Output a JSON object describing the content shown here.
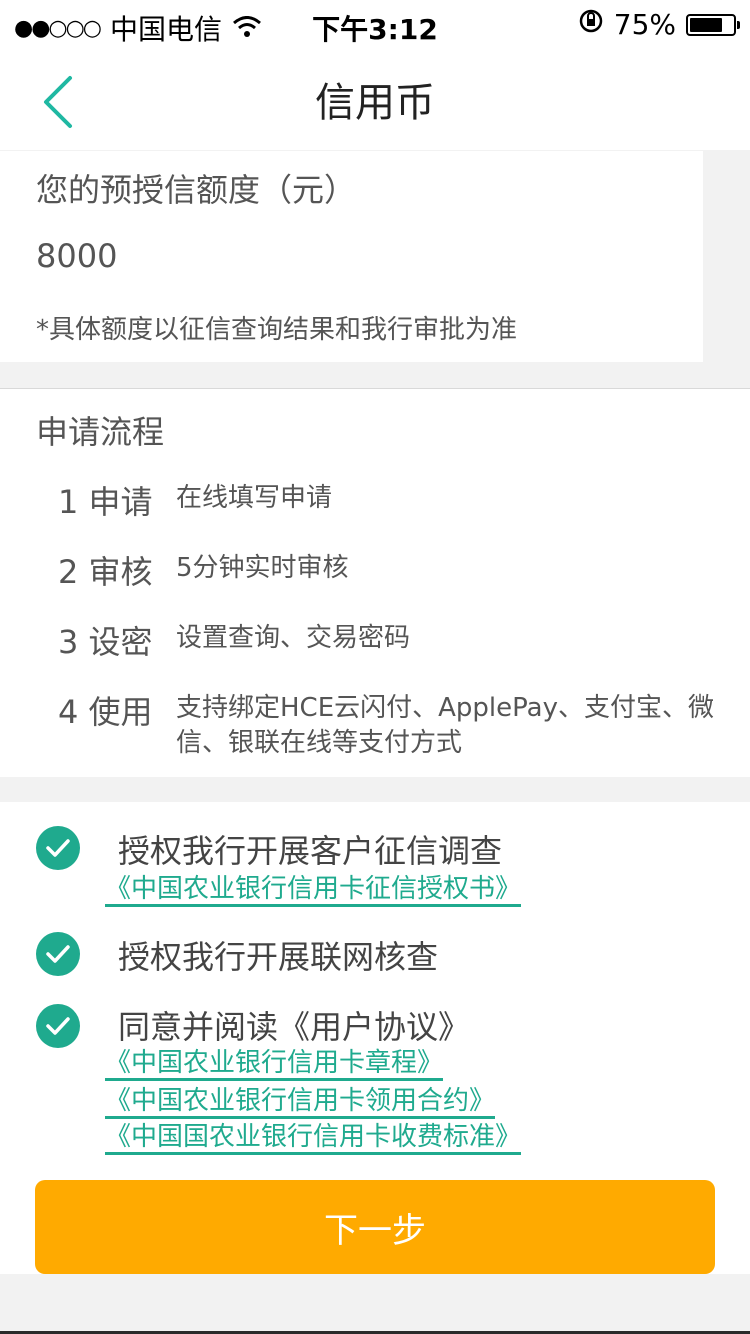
{
  "status_bar": {
    "signal": "●●○○○",
    "carrier": "中国电信",
    "time": "下午3:12",
    "battery_percent": "75%",
    "battery_level": 0.75
  },
  "nav": {
    "title": "信用币",
    "back_icon": "chevron-left-icon"
  },
  "quota": {
    "label": "您的预授信额度（元）",
    "amount": "8000",
    "note": "*具体额度以征信查询结果和我行审批为准"
  },
  "process": {
    "title": "申请流程",
    "steps": [
      {
        "no": "1 申请",
        "desc": "在线填写申请"
      },
      {
        "no": "2 审核",
        "desc": "5分钟实时审核"
      },
      {
        "no": "3 设密",
        "desc": "设置查询、交易密码"
      },
      {
        "no": "4 使用",
        "desc": "支持绑定HCE云闪付、ApplePay、支付宝、微信、银联在线等支付方式"
      }
    ]
  },
  "agreements": {
    "items": [
      {
        "text": "授权我行开展客户征信调查",
        "links": [
          "《中国农业银行信用卡征信授权书》"
        ]
      },
      {
        "text": "授权我行开展联网核查",
        "links": []
      },
      {
        "text": "同意并阅读《用户协议》",
        "links": [
          "《中国农业银行信用卡章程》",
          "《中国农业银行信用卡领用合约》",
          "《中国国农业银行信用卡收费标准》"
        ]
      }
    ]
  },
  "colors": {
    "accent": "#1faa8e",
    "button": "#ffaa00"
  },
  "next_button": "下一步"
}
